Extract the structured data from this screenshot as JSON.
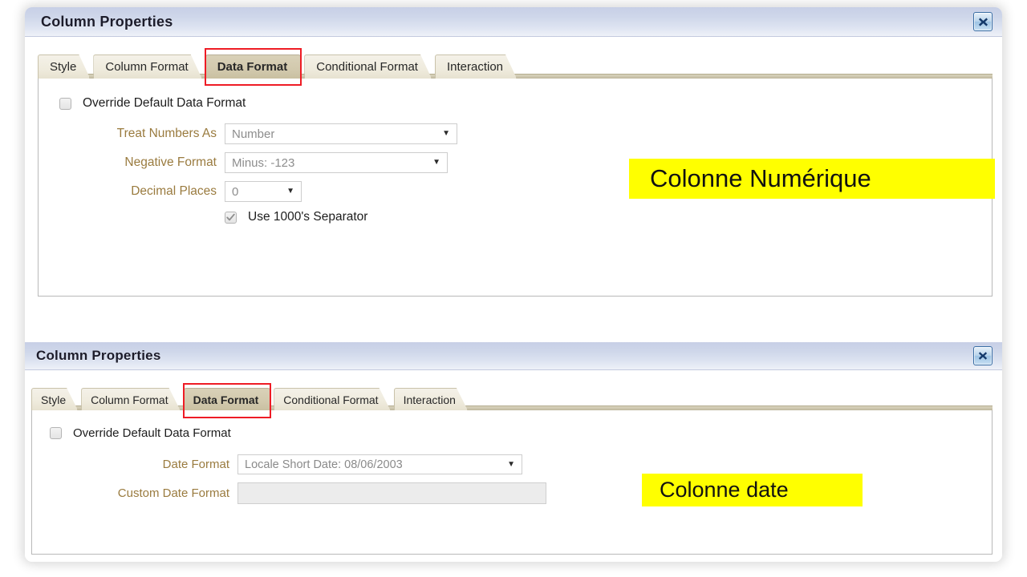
{
  "dialogs": [
    {
      "title": "Column Properties",
      "close_icon": "close-icon",
      "tabs": [
        {
          "label": "Style",
          "active": false
        },
        {
          "label": "Column Format",
          "active": false
        },
        {
          "label": "Data Format",
          "active": true
        },
        {
          "label": "Conditional Format",
          "active": false
        },
        {
          "label": "Interaction",
          "active": false
        }
      ],
      "override": {
        "label": "Override Default Data Format",
        "checked": false
      },
      "fields": [
        {
          "label": "Treat Numbers As",
          "value": "Number",
          "caret": "▼"
        },
        {
          "label": "Negative Format",
          "value": "Minus: -123",
          "caret": "▼"
        },
        {
          "label": "Decimal Places",
          "value": "0",
          "caret": "▼"
        }
      ],
      "separator": {
        "label": "Use 1000's Separator",
        "checked": true
      },
      "annotation": "Colonne Numérique"
    },
    {
      "title": "Column Properties",
      "close_icon": "close-icon",
      "tabs": [
        {
          "label": "Style",
          "active": false
        },
        {
          "label": "Column Format",
          "active": false
        },
        {
          "label": "Data Format",
          "active": true
        },
        {
          "label": "Conditional Format",
          "active": false
        },
        {
          "label": "Interaction",
          "active": false
        }
      ],
      "override": {
        "label": "Override Default Data Format",
        "checked": false
      },
      "date_format": {
        "label": "Date Format",
        "value": "Locale Short Date: 08/06/2003",
        "caret": "▼"
      },
      "custom_date_format": {
        "label": "Custom Date Format",
        "value": "",
        "placeholder": ""
      },
      "annotation": "Colonne date"
    }
  ],
  "colors": {
    "accent_red": "#ee1c25",
    "highlight_yellow": "#ffff00",
    "label_brown": "#9a7b3f",
    "titlebar_blue": "#cfd7ea",
    "active_tab": "#d2c9ad"
  }
}
